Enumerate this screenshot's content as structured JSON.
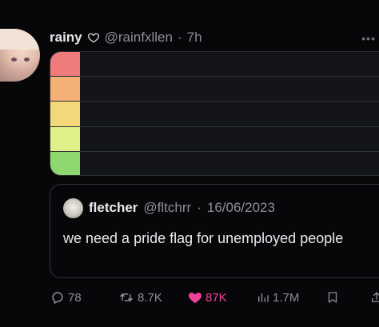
{
  "tweet": {
    "author_name": "rainy",
    "author_handle": "@rainfxllen",
    "separator": "·",
    "time": "7h"
  },
  "tier_list": {
    "rows": [
      {
        "color": "#ef7b7b"
      },
      {
        "color": "#f4b077"
      },
      {
        "color": "#f3d87a"
      },
      {
        "color": "#dff08a"
      },
      {
        "color": "#8fd86f"
      }
    ]
  },
  "quote": {
    "author_name": "fletcher",
    "author_handle": "@fltchrr",
    "separator": "·",
    "date": "16/06/2023",
    "text": "we need a pride flag for unemployed people"
  },
  "actions": {
    "replies": "78",
    "retweets": "8.7K",
    "likes": "87K",
    "views": "1.7M",
    "like_color": "#f0429a"
  }
}
